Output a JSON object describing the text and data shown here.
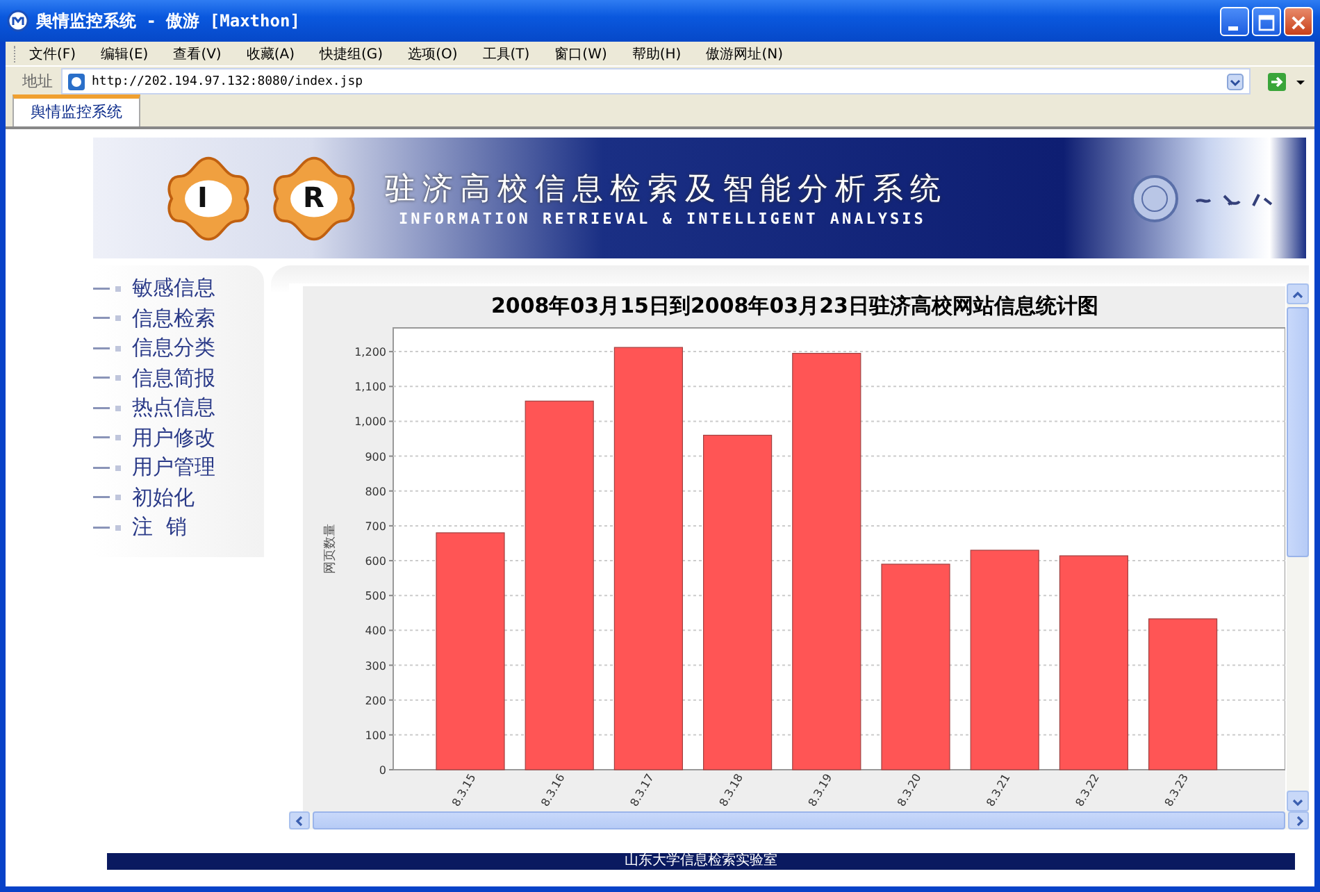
{
  "window": {
    "title": "舆情监控系统 - 傲游 [Maxthon]"
  },
  "menu": [
    "文件(F)",
    "编辑(E)",
    "查看(V)",
    "收藏(A)",
    "快捷组(G)",
    "选项(O)",
    "工具(T)",
    "窗口(W)",
    "帮助(H)",
    "傲游网址(N)"
  ],
  "address_bar": {
    "label": "地址",
    "value": "http://202.194.97.132:8080/index.jsp"
  },
  "tabs": [
    {
      "label": "舆情监控系统",
      "selected": true
    }
  ],
  "banner": {
    "title": "驻济高校信息检索及智能分析系统",
    "subtitle": "INFORMATION RETRIEVAL & INTELLIGENT ANALYSIS",
    "logo_letters": [
      "I",
      "R"
    ]
  },
  "sidebar": {
    "items": [
      "敏感信息",
      "信息检索",
      "信息分类",
      "信息简报",
      "热点信息",
      "用户修改",
      "用户管理",
      "初始化",
      "注  销"
    ]
  },
  "chart_data": {
    "type": "bar",
    "title": "2008年03月15日到2008年03月23日驻济高校网站信息统计图",
    "ylabel": "网页数量",
    "categories": [
      "8.3.15",
      "8.3.16",
      "8.3.17",
      "8.3.18",
      "8.3.19",
      "8.3.20",
      "8.3.21",
      "8.3.22",
      "8.3.23"
    ],
    "values": [
      680,
      1058,
      1212,
      960,
      1195,
      590,
      630,
      614,
      433
    ],
    "grid": true,
    "ylim": [
      0,
      1268
    ],
    "yticks": [
      0,
      100,
      200,
      300,
      400,
      500,
      600,
      700,
      800,
      900,
      {
        "value": 1000,
        "label": "1,000"
      },
      {
        "value": 1100,
        "label": "1,100"
      },
      {
        "value": 1200,
        "label": "1,200"
      }
    ]
  },
  "footer": "山东大学信息检索实验室"
}
